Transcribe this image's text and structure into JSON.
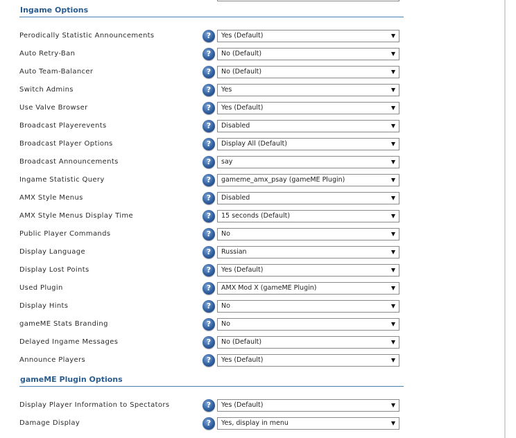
{
  "sections": [
    {
      "title": "Ingame Options",
      "rows": [
        {
          "label": "Perodically Statistic Announcements",
          "value": "Yes (Default)"
        },
        {
          "label": "Auto Retry-Ban",
          "value": "No (Default)"
        },
        {
          "label": "Auto Team-Balancer",
          "value": "No (Default)"
        },
        {
          "label": "Switch Admins",
          "value": "Yes"
        },
        {
          "label": "Use Valve Browser",
          "value": "Yes (Default)"
        },
        {
          "label": "Broadcast Playerevents",
          "value": "Disabled"
        },
        {
          "label": "Broadcast Player Options",
          "value": "Display All (Default)"
        },
        {
          "label": "Broadcast Announcements",
          "value": "say"
        },
        {
          "label": "Ingame Statistic Query",
          "value": "gameme_amx_psay (gameME Plugin)"
        },
        {
          "label": "AMX Style Menus",
          "value": "Disabled"
        },
        {
          "label": "AMX Style Menus Display Time",
          "value": "15 seconds (Default)"
        },
        {
          "label": "Public Player Commands",
          "value": "No"
        },
        {
          "label": "Display Language",
          "value": "Russian"
        },
        {
          "label": "Display Lost Points",
          "value": "Yes (Default)"
        },
        {
          "label": "Used Plugin",
          "value": "AMX Mod X (gameME Plugin)"
        },
        {
          "label": "Display Hints",
          "value": "No"
        },
        {
          "label": "gameME Stats Branding",
          "value": "No"
        },
        {
          "label": "Delayed Ingame Messages",
          "value": "No (Default)"
        },
        {
          "label": "Announce Players",
          "value": "Yes (Default)"
        }
      ]
    },
    {
      "title": "gameME Plugin Options",
      "rows": [
        {
          "label": "Display Player Information to Spectators",
          "value": "Yes (Default)"
        },
        {
          "label": "Damage Display",
          "value": "Yes, display in menu"
        }
      ]
    }
  ],
  "help_icon": {
    "glyph": "?",
    "name": "help-icon",
    "color": "#2f5f9e"
  },
  "dropdown_icon": "chevron-down-icon"
}
